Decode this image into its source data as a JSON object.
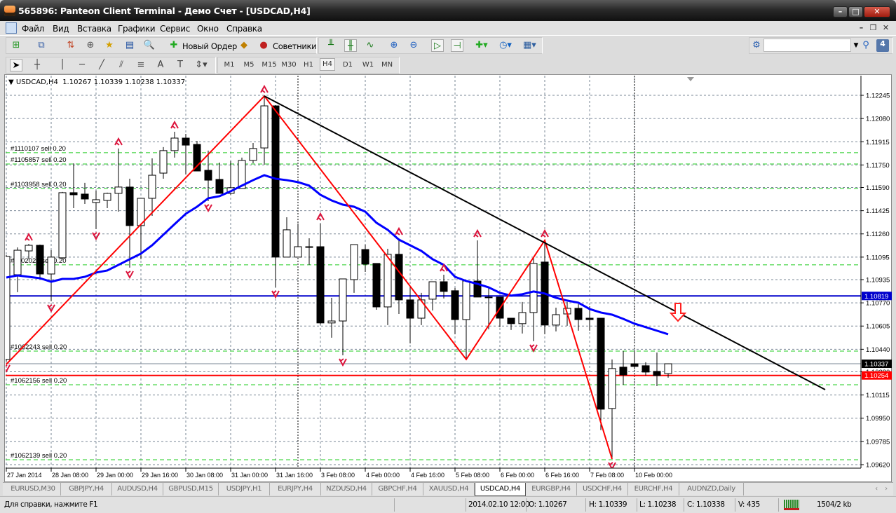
{
  "window": {
    "title": "565896: Panteon Client Terminal - Демо Счет - [USDCAD,H4]",
    "minimize": "–",
    "maximize": "□",
    "close": "✕"
  },
  "menu": {
    "items": [
      "Файл",
      "Вид",
      "Вставка",
      "Графики",
      "Сервис",
      "Окно",
      "Справка"
    ],
    "doc_minimize": "–",
    "doc_restore": "❐",
    "doc_close": "✕"
  },
  "toolbar": {
    "new_order": "Новый Ордер",
    "experts": "Советники",
    "timeframes": [
      "M1",
      "M5",
      "M15",
      "M30",
      "H1",
      "H4",
      "D1",
      "W1",
      "MN"
    ],
    "active_timeframe": "H4",
    "search_value": "",
    "notification_count": "4"
  },
  "chart": {
    "header": {
      "symbol": "USDCAD,H4",
      "ohlc": "1.10267 1.10339 1.10238 1.10337"
    }
  },
  "chart_data": {
    "type": "candlestick",
    "symbol": "USDCAD",
    "timeframe": "H4",
    "ylim": [
      1.0962,
      1.1238
    ],
    "grid": true,
    "price_ticks": [
      "1.12245",
      "1.12080",
      "1.11915",
      "1.11750",
      "1.11590",
      "1.11425",
      "1.11260",
      "1.11095",
      "1.10935",
      "1.10770",
      "1.10605",
      "1.10440",
      "1.10280",
      "1.10115",
      "1.09950",
      "1.09785",
      "1.09620"
    ],
    "time_labels": [
      {
        "index": 0,
        "label": "27 Jan 2014"
      },
      {
        "index": 4,
        "label": "28 Jan 08:00"
      },
      {
        "index": 8,
        "label": "29 Jan 00:00"
      },
      {
        "index": 12,
        "label": "29 Jan 16:00"
      },
      {
        "index": 16,
        "label": "30 Jan 08:00"
      },
      {
        "index": 20,
        "label": "31 Jan 00:00"
      },
      {
        "index": 24,
        "label": "31 Jan 16:00"
      },
      {
        "index": 28,
        "label": "3 Feb 08:00"
      },
      {
        "index": 32,
        "label": "4 Feb 00:00"
      },
      {
        "index": 36,
        "label": "4 Feb 16:00"
      },
      {
        "index": 40,
        "label": "5 Feb 08:00"
      },
      {
        "index": 44,
        "label": "6 Feb 00:00"
      },
      {
        "index": 48,
        "label": "6 Feb 16:00"
      },
      {
        "index": 52,
        "label": "7 Feb 08:00"
      },
      {
        "index": 56,
        "label": "10 Feb 00:00"
      }
    ],
    "candles": [
      [
        1.10368,
        1.1111,
        1.10353,
        1.111
      ],
      [
        1.1097,
        1.11164,
        1.10846,
        1.11144
      ],
      [
        1.11139,
        1.11189,
        1.1108,
        1.11179
      ],
      [
        1.11179,
        1.11184,
        1.1094,
        1.10975
      ],
      [
        1.10975,
        1.11144,
        1.10781,
        1.11095
      ],
      [
        1.1109,
        1.11558,
        1.1108,
        1.11553
      ],
      [
        1.11553,
        1.11762,
        1.11443,
        1.11538
      ],
      [
        1.11543,
        1.11623,
        1.11473,
        1.11508
      ],
      [
        1.11483,
        1.11568,
        1.11294,
        1.11503
      ],
      [
        1.11498,
        1.11553,
        1.11443,
        1.11548
      ],
      [
        1.11548,
        1.11867,
        1.11418,
        1.11593
      ],
      [
        1.11593,
        1.11652,
        1.1102,
        1.11319
      ],
      [
        1.11319,
        1.11513,
        1.1108,
        1.11513
      ],
      [
        1.11513,
        1.11797,
        1.11388,
        1.11677
      ],
      [
        1.11692,
        1.11877,
        1.11652,
        1.11852
      ],
      [
        1.11852,
        1.11986,
        1.11802,
        1.11941
      ],
      [
        1.11941,
        1.11971,
        1.11682,
        1.11891
      ],
      [
        1.11896,
        1.11921,
        1.11707,
        1.11707
      ],
      [
        1.11712,
        1.11852,
        1.11493,
        1.11642
      ],
      [
        1.11647,
        1.11767,
        1.11548,
        1.11548
      ],
      [
        1.11548,
        1.11777,
        1.11538,
        1.11588
      ],
      [
        1.11583,
        1.11802,
        1.11583,
        1.11782
      ],
      [
        1.11782,
        1.11906,
        1.11762,
        1.11867
      ],
      [
        1.11871,
        1.1224,
        1.11752,
        1.1217
      ],
      [
        1.1217,
        1.12175,
        1.1088,
        1.11095
      ],
      [
        1.11095,
        1.11378,
        1.11095,
        1.11289
      ],
      [
        1.11095,
        1.11334,
        1.11095,
        1.11169
      ],
      [
        1.11169,
        1.11229,
        1.1104,
        1.11169
      ],
      [
        1.11169,
        1.11334,
        1.10617,
        1.10627
      ],
      [
        1.10627,
        1.10806,
        1.10522,
        1.10641
      ],
      [
        1.10641,
        1.1094,
        1.10397,
        1.1094
      ],
      [
        1.10935,
        1.11184,
        1.10841,
        1.11184
      ],
      [
        1.11149,
        1.11184,
        1.1099,
        1.11045
      ],
      [
        1.1105,
        1.1105,
        1.10721,
        1.10741
      ],
      [
        1.10741,
        1.11154,
        1.10612,
        1.11115
      ],
      [
        1.11115,
        1.11229,
        1.10691,
        1.10791
      ],
      [
        1.10791,
        1.1088,
        1.10482,
        1.10661
      ],
      [
        1.10661,
        1.10841,
        1.10612,
        1.10791
      ],
      [
        1.10796,
        1.1092,
        1.10716,
        1.1092
      ],
      [
        1.1092,
        1.1097,
        1.10801,
        1.10851
      ],
      [
        1.10856,
        1.10876,
        1.10547,
        1.10651
      ],
      [
        1.10651,
        1.10925,
        1.10368,
        1.10925
      ],
      [
        1.10925,
        1.11214,
        1.10811,
        1.10811
      ],
      [
        1.10811,
        1.1088,
        1.10582,
        1.10811
      ],
      [
        1.10811,
        1.10811,
        1.10597,
        1.10661
      ],
      [
        1.10661,
        1.10661,
        1.10577,
        1.10622
      ],
      [
        1.10622,
        1.10776,
        1.10552,
        1.10701
      ],
      [
        1.10701,
        1.1109,
        1.10497,
        1.1105
      ],
      [
        1.1106,
        1.11214,
        1.10547,
        1.10612
      ],
      [
        1.10612,
        1.10736,
        1.10567,
        1.10686
      ],
      [
        1.10691,
        1.10776,
        1.10607,
        1.10731
      ],
      [
        1.10731,
        1.10761,
        1.10572,
        1.10651
      ],
      [
        1.10661,
        1.10746,
        1.10572,
        1.10651
      ],
      [
        1.10661,
        1.10661,
        1.09865,
        1.10014
      ],
      [
        1.10019,
        1.10368,
        1.0966,
        1.10303
      ],
      [
        1.10313,
        1.10427,
        1.10188,
        1.10258
      ],
      [
        1.10337,
        1.10427,
        1.10298,
        1.10318
      ],
      [
        1.10323,
        1.10348,
        1.10253,
        1.10278
      ],
      [
        1.10283,
        1.10417,
        1.10178,
        1.10253
      ],
      [
        1.10267,
        1.10339,
        1.10238,
        1.10337
      ]
    ],
    "moving_average": [
      1.1095,
      1.10965,
      1.10955,
      1.10945,
      1.1092,
      1.1094,
      1.1094,
      1.10955,
      1.10985,
      1.11,
      1.1104,
      1.1108,
      1.1112,
      1.11179,
      1.11254,
      1.11329,
      1.11403,
      1.11453,
      1.11513,
      1.11528,
      1.11563,
      1.11603,
      1.11642,
      1.11677,
      1.11652,
      1.11642,
      1.11628,
      1.11603,
      1.11538,
      1.11498,
      1.11468,
      1.11453,
      1.11418,
      1.11339,
      1.11289,
      1.11219,
      1.11179,
      1.11139,
      1.1108,
      1.1104,
      1.10955,
      1.10925,
      1.10905,
      1.1088,
      1.10841,
      1.10821,
      1.10831,
      1.10851,
      1.10836,
      1.10806,
      1.10786,
      1.10771,
      1.10726,
      1.10701,
      1.10686,
      1.10656,
      1.10622,
      1.10597,
      1.10572,
      1.10547
    ],
    "ma_color": "#0000ff",
    "zigzag": [
      [
        0,
        1.10333
      ],
      [
        23,
        1.1224
      ],
      [
        41,
        1.10368
      ],
      [
        48,
        1.11214
      ],
      [
        54,
        1.0966
      ]
    ],
    "zigzag_color": "#ff0000",
    "trendline": [
      [
        23,
        1.1224
      ],
      [
        73,
        1.10153
      ]
    ],
    "fractals_up": [
      2,
      10,
      15,
      23,
      28,
      35,
      39,
      42,
      48
    ],
    "fractals_down": [
      0,
      4,
      8,
      11,
      18,
      24,
      30,
      47,
      54
    ],
    "period_separators": [
      26,
      56
    ],
    "orders": [
      {
        "label": "#1110107 sell 0.20",
        "price": 1.11837
      },
      {
        "label": "#1105857 sell 0.20",
        "price": 1.11757
      },
      {
        "label": "#1103958 sell 0.20",
        "price": 1.11583
      },
      {
        "label": "#1102022 sell 0.20",
        "price": 1.1104
      },
      {
        "label": "#1062243 sell 0.20",
        "price": 1.10427
      },
      {
        "label": "#1062156 sell 0.20",
        "price": 1.10188
      },
      {
        "label": "#1062139 sell 0.20",
        "price": 1.09655
      }
    ],
    "levels": [
      {
        "price": 1.10819,
        "label": "1.10819",
        "color": "#0000cc"
      },
      {
        "price": 1.10254,
        "label": "1.10254",
        "color": "#ff0000"
      }
    ],
    "bid": {
      "price": 1.10337,
      "label": "1.10337",
      "color": "#000000"
    }
  },
  "tabs": {
    "items": [
      "EURUSD,M30",
      "GBPJPY,H4",
      "AUDUSD,H4",
      "GBPUSD,M15",
      "USDJPY,H1",
      "EURJPY,H4",
      "NZDUSD,H4",
      "GBPCHF,H4",
      "XAUUSD,H4",
      "USDCAD,H4",
      "EURGBP,H4",
      "USDCHF,H4",
      "EURCHF,H4",
      "AUDNZD,Daily"
    ],
    "active": "USDCAD,H4",
    "scroll_left": "‹",
    "scroll_right": "›"
  },
  "status": {
    "help": "Для справки, нажмите F1",
    "datetime": "2014.02.10 12:00",
    "open": "O: 1.10267",
    "high": "H: 1.10339",
    "low": "L: 1.10238",
    "close": "C: 1.10338",
    "volume": "V: 435",
    "traffic": "1504/2 kb"
  }
}
